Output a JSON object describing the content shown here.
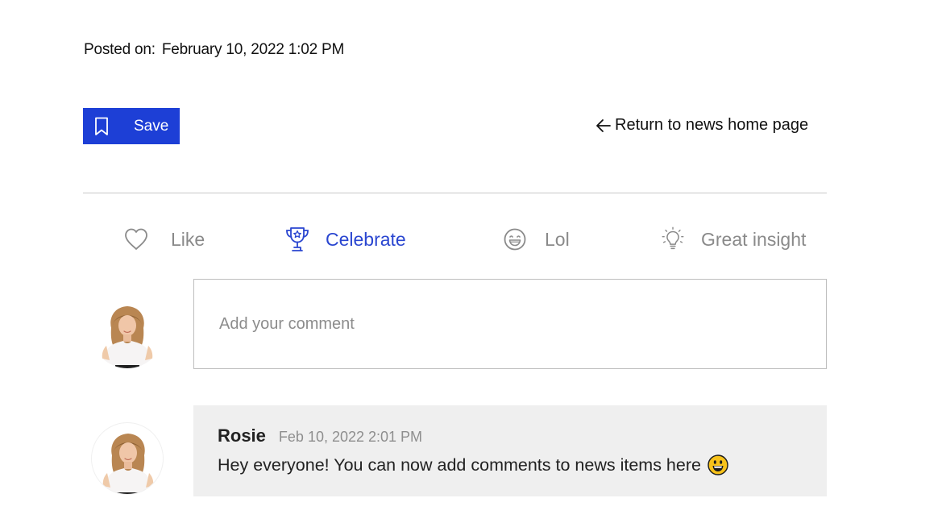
{
  "post": {
    "posted_label": "Posted on:",
    "posted_date": "February 10, 2022 1:02 PM"
  },
  "toolbar": {
    "save_label": "Save",
    "save_icon": "bookmark-icon",
    "return_label": "Return to news home page",
    "return_icon": "arrow-left-icon"
  },
  "reactions": [
    {
      "label": "Like",
      "icon": "heart-icon",
      "active": false
    },
    {
      "label": "Celebrate",
      "icon": "trophy-icon",
      "active": true
    },
    {
      "label": "Lol",
      "icon": "laughing-face-icon",
      "active": false
    },
    {
      "label": "Great insight",
      "icon": "lightbulb-icon",
      "active": false
    }
  ],
  "comment_input": {
    "placeholder": "Add your comment"
  },
  "comments": [
    {
      "author": "Rosie",
      "time": "Feb 10, 2022 2:01 PM",
      "text": "Hey everyone! You can now add comments to news items here",
      "emoji": "smiling-face-icon"
    }
  ],
  "colors": {
    "accent": "#1d3fd6",
    "active_reaction": "#2a46d0",
    "muted": "#8a8a8a",
    "comment_bg": "#efefef",
    "emoji_yellow": "#f7c21a"
  }
}
